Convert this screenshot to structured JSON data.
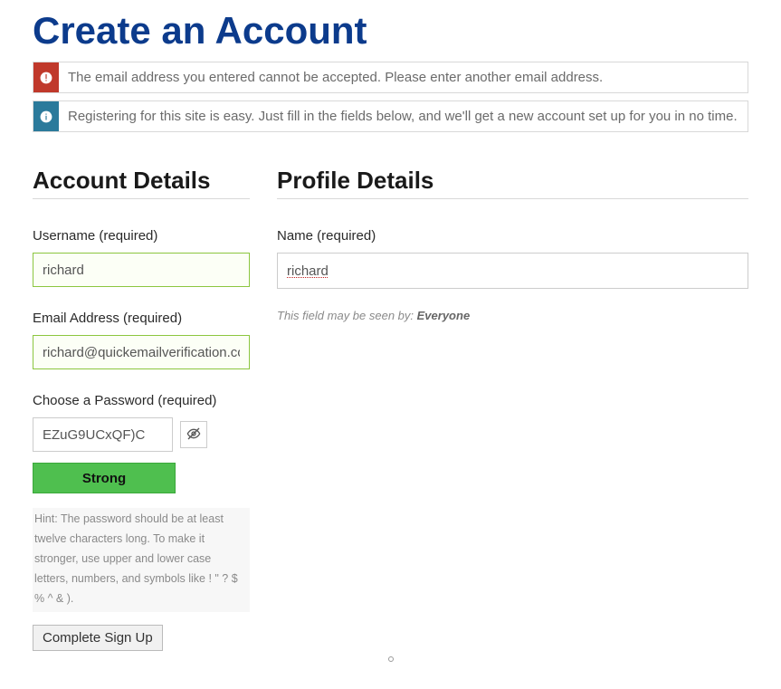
{
  "page_title": "Create an Account",
  "alerts": {
    "error": "The email address you entered cannot be accepted. Please enter another email address.",
    "info": "Registering for this site is easy. Just fill in the fields below, and we'll get a new account set up for you in no time."
  },
  "account": {
    "section_title": "Account Details",
    "username_label": "Username (required)",
    "username_value": "richard",
    "email_label": "Email Address (required)",
    "email_value": "richard@quickemailverification.com",
    "password_label": "Choose a Password (required)",
    "password_value": "EZuG9UCxQF)C",
    "password_strength": "Strong",
    "password_hint": "Hint: The password should be at least twelve characters long. To make it stronger, use upper and lower case letters, numbers, and symbols like ! \" ? $ % ^ & )."
  },
  "profile": {
    "section_title": "Profile Details",
    "name_label": "Name (required)",
    "name_value": "richard",
    "privacy_prefix": "This field may be seen by: ",
    "privacy_value": "Everyone"
  },
  "submit_label": "Complete Sign Up",
  "icons": {
    "error": "error-icon",
    "info": "info-icon",
    "eye": "eye-slash-icon"
  }
}
